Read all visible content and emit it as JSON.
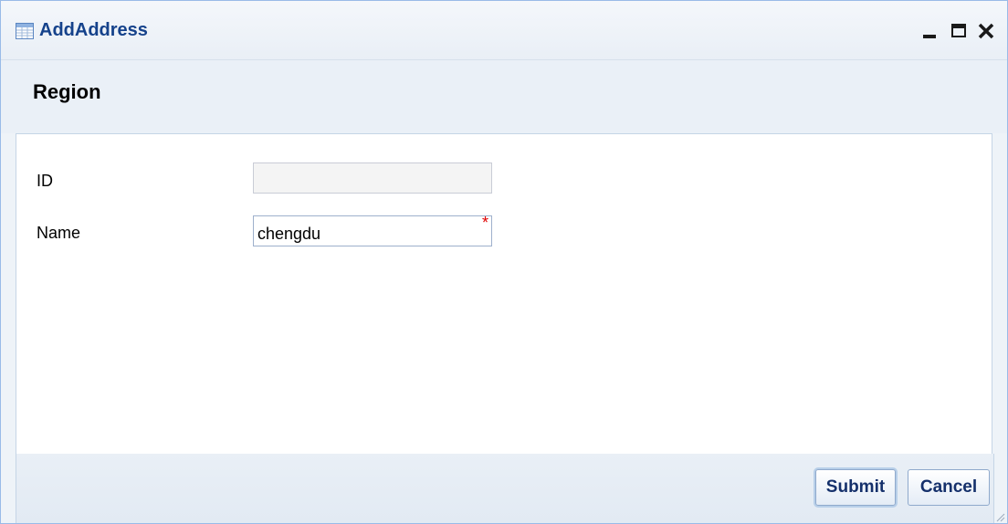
{
  "window": {
    "title": "AddAddress",
    "icon": "form-table-icon",
    "controls": [
      "minimize-icon",
      "maximize-icon",
      "close-icon"
    ]
  },
  "region": {
    "title": "Region"
  },
  "form": {
    "id_label": "ID",
    "id_value": "",
    "name_label": "Name",
    "name_value": "chengdu",
    "required_marker": "*"
  },
  "footer": {
    "submit_label": "Submit",
    "cancel_label": "Cancel"
  },
  "colors": {
    "title_text": "#15428b",
    "border": "#99bbe8",
    "required": "#e00000",
    "button_text": "#15306b"
  }
}
